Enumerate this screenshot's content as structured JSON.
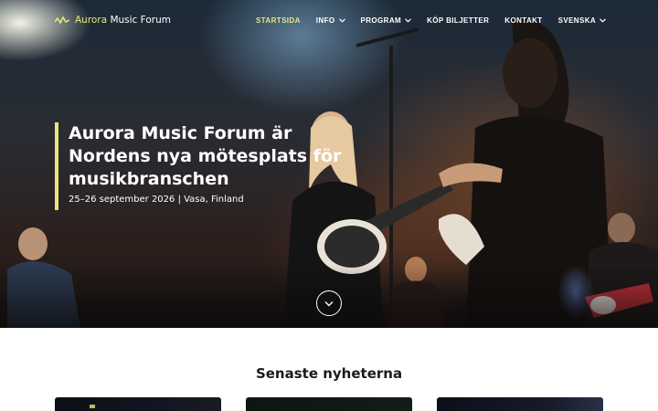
{
  "brand": {
    "name_part1": "Aurora",
    "name_part2": " Music Forum",
    "accent_color": "#e8e57a",
    "logo_icon": "waveform-icon"
  },
  "nav": {
    "items": [
      {
        "label": "STARTSIDA",
        "active": true,
        "has_dropdown": false
      },
      {
        "label": "INFO",
        "active": false,
        "has_dropdown": true
      },
      {
        "label": "PROGRAM",
        "active": false,
        "has_dropdown": true
      },
      {
        "label": "KÖP BILJETTER",
        "active": false,
        "has_dropdown": false
      },
      {
        "label": "KONTAKT",
        "active": false,
        "has_dropdown": false
      },
      {
        "label": "SVENSKA",
        "active": false,
        "has_dropdown": true
      }
    ]
  },
  "hero": {
    "title": "Aurora Music Forum är Nordens nya mötesplats för musikbranschen",
    "subtitle": "25–26 september 2026 | Vasa, Finland",
    "scroll_icon": "chevron-down-icon"
  },
  "news": {
    "heading": "Senaste nyheterna",
    "cards": [
      {
        "id": "card-1"
      },
      {
        "id": "card-2"
      },
      {
        "id": "card-3"
      }
    ]
  }
}
